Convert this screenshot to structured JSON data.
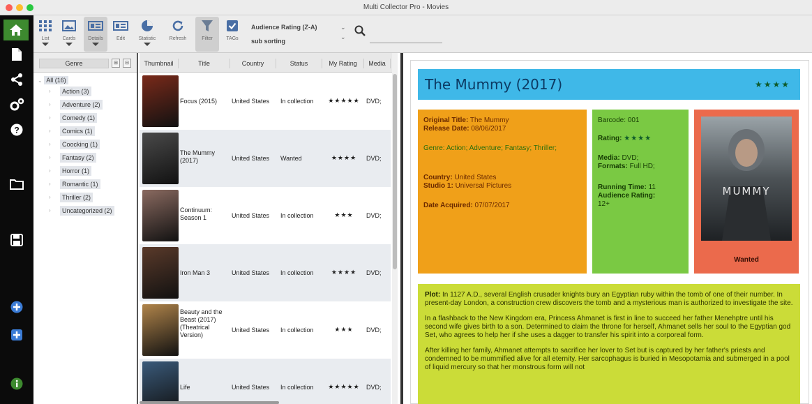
{
  "window": {
    "title": "Multi Collector Pro - Movies"
  },
  "toolbar": {
    "buttons": [
      {
        "label": "List"
      },
      {
        "label": "Cards"
      },
      {
        "label": "Details"
      },
      {
        "label": "Edit"
      },
      {
        "label": "Statistic"
      },
      {
        "label": "Refresh"
      },
      {
        "label": "Filter"
      },
      {
        "label": "TAGs"
      }
    ],
    "sort_label": "Audience Rating (Z-A)",
    "sub_sort_label": "sub sorting",
    "search_placeholder": ""
  },
  "genre_panel": {
    "header": "Genre",
    "collapse_btn": "⊞",
    "expand_btn": "⊟",
    "root": "All (16)",
    "items": [
      {
        "label": "Action (3)"
      },
      {
        "label": "Adventure (2)"
      },
      {
        "label": "Comedy (1)"
      },
      {
        "label": "Comics (1)"
      },
      {
        "label": "Coocking (1)"
      },
      {
        "label": "Fantasy (2)"
      },
      {
        "label": "Horror (1)"
      },
      {
        "label": "Romantic (1)"
      },
      {
        "label": "Thriller (2)"
      },
      {
        "label": "Uncategorized (2)"
      }
    ]
  },
  "movie_list": {
    "columns": [
      "Thumbnail",
      "Title",
      "Country",
      "Status",
      "My Rating",
      "Media"
    ],
    "rows": [
      {
        "title": "Focus (2015)",
        "country": "United States",
        "status": "In collection",
        "rating": "★★★★★",
        "media": "DVD;",
        "thumb_color": "#7a2a1a"
      },
      {
        "title": "The Mummy (2017)",
        "country": "United States",
        "status": "Wanted",
        "rating": "★★★★",
        "media": "DVD;",
        "thumb_color": "#4a4a4a"
      },
      {
        "title": "Continuum: Season 1",
        "country": "United States",
        "status": "In collection",
        "rating": "★★★",
        "media": "DVD;",
        "thumb_color": "#8a6a60"
      },
      {
        "title": "Iron Man 3",
        "country": "United States",
        "status": "In collection",
        "rating": "★★★★",
        "media": "DVD;",
        "thumb_color": "#5a3a2a"
      },
      {
        "title": "Beauty and the Beast (2017) (Theatrical Version)",
        "country": "United States",
        "status": "In collection",
        "rating": "★★★",
        "media": "DVD;",
        "thumb_color": "#b0844a"
      },
      {
        "title": "Life",
        "country": "United States",
        "status": "In collection",
        "rating": "★★★★★",
        "media": "DVD;",
        "thumb_color": "#3a5a7a"
      }
    ]
  },
  "detail": {
    "title": "The Mummy (2017)",
    "stars": "★★★★",
    "original_title_label": "Original Title:",
    "original_title": "The Mummy",
    "release_date_label": "Release Date:",
    "release_date": "08/06/2017",
    "genre_label": "Genre:",
    "genre": "Action; Adventure; Fantasy; Thriller;",
    "country_label": "Country:",
    "country": "United States",
    "studio_label": "Studio 1:",
    "studio": "Universal Pictures",
    "date_acquired_label": "Date Acquired:",
    "date_acquired": "07/07/2017",
    "barcode_label": "Barcode:",
    "barcode": "001",
    "rating_label": "Rating:",
    "rating": "★★★★",
    "media_label": "Media:",
    "media": "DVD;",
    "formats_label": "Formats:",
    "formats": "Full HD;",
    "running_time_label": "Running Time:",
    "running_time": "11",
    "audience_rating_label": "Audience Rating:",
    "audience_rating": "12+",
    "poster_text": "MUMMY",
    "status": "Wanted",
    "plot_label": "Plot:",
    "plot_p1": "In 1127 A.D., several English crusader knights bury an Egyptian ruby within the tomb of one of their number. In present-day London, a construction crew discovers the tomb and a mysterious man is authorized to investigate the site.",
    "plot_p2": "In a flashback to the New Kingdom era, Princess Ahmanet is first in line to succeed her father Menehptre until his second wife gives birth to a son. Determined to claim the throne for herself, Ahmanet sells her soul to the Egyptian god Set, who agrees to help her if she uses a dagger to transfer his spirit into a corporeal form.",
    "plot_p3": "After killing her family, Ahmanet attempts to sacrifice her lover to Set but is captured by her father's priests and condemned to be mummified alive for all eternity. Her sarcophagus is buried in Mesopotamia and submerged in a pool of liquid mercury so that her monstrous form will not"
  }
}
